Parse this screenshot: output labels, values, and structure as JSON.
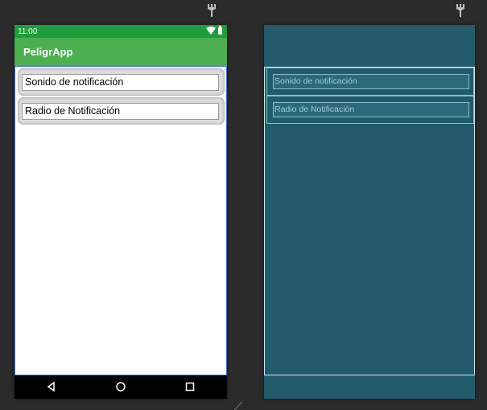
{
  "design_view": {
    "status_bar": {
      "time": "11:00"
    },
    "app_bar": {
      "title": "PeligrApp"
    },
    "preferences": [
      {
        "label": "Sonido de notificación"
      },
      {
        "label": "Radio de Notificación"
      }
    ]
  },
  "blueprint_view": {
    "preferences": [
      {
        "label": "Sonido de notificación"
      },
      {
        "label": "Radio de Notificación"
      }
    ]
  },
  "colors": {
    "status_bar": "#1e9e3a",
    "app_bar": "#4caf50",
    "blueprint_bg": "#225b6b",
    "editor_bg": "#2b2b2b"
  },
  "icons": [
    "pin-icon",
    "wifi-icon",
    "battery-icon",
    "back-icon",
    "home-icon",
    "recents-icon",
    "resize-handle-icon"
  ]
}
